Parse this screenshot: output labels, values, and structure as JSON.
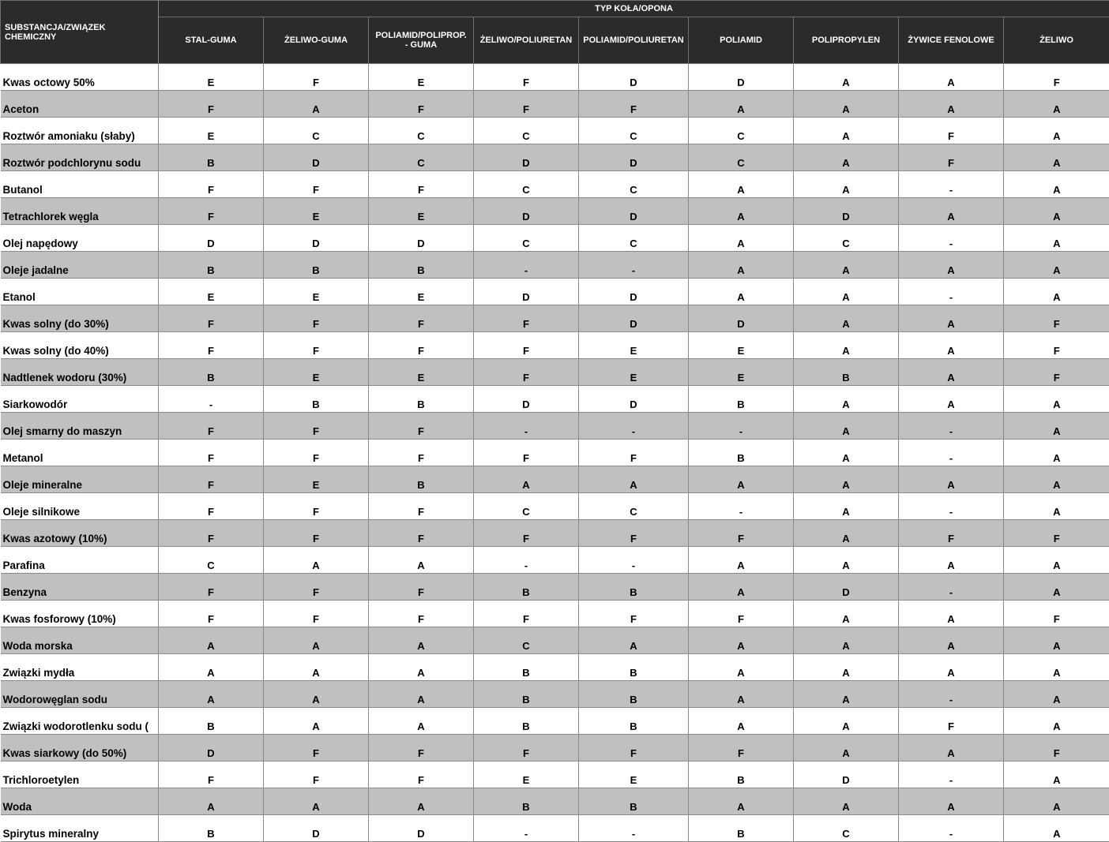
{
  "header": {
    "first_col": "SUBSTANCJA/ZWIĄZEK CHEMICZNY",
    "group": "TYP KOŁA/OPONA",
    "columns": [
      "STAL-GUMA",
      "ŻELIWO-GUMA",
      "POLIAMID/POLIPROP.\n- GUMA",
      "ŻELIWO/POLIURETAN",
      "POLIAMID/POLIURETAN",
      "POLIAMID",
      "POLIPROPYLEN",
      "ŻYWICE FENOLOWE",
      "ŻELIWO"
    ]
  },
  "rows": [
    {
      "name": "Kwas octowy 50%",
      "values": [
        "E",
        "F",
        "E",
        "F",
        "D",
        "D",
        "A",
        "A",
        "F"
      ]
    },
    {
      "name": "Aceton",
      "values": [
        "F",
        "A",
        "F",
        "F",
        "F",
        "A",
        "A",
        "A",
        "A"
      ]
    },
    {
      "name": "Roztwór amoniaku (słaby)",
      "values": [
        "E",
        "C",
        "C",
        "C",
        "C",
        "C",
        "A",
        "F",
        "A"
      ]
    },
    {
      "name": "Roztwór podchlorynu sodu",
      "values": [
        "B",
        "D",
        "C",
        "D",
        "D",
        "C",
        "A",
        "F",
        "A"
      ]
    },
    {
      "name": "Butanol",
      "values": [
        "F",
        "F",
        "F",
        "C",
        "C",
        "A",
        "A",
        "-",
        "A"
      ]
    },
    {
      "name": "Tetrachlorek węgla",
      "values": [
        "F",
        "E",
        "E",
        "D",
        "D",
        "A",
        "D",
        "A",
        "A"
      ]
    },
    {
      "name": "Olej napędowy",
      "values": [
        "D",
        "D",
        "D",
        "C",
        "C",
        "A",
        "C",
        "-",
        "A"
      ]
    },
    {
      "name": "Oleje jadalne",
      "values": [
        "B",
        "B",
        "B",
        "-",
        "-",
        "A",
        "A",
        "A",
        "A"
      ]
    },
    {
      "name": "Etanol",
      "values": [
        "E",
        "E",
        "E",
        "D",
        "D",
        "A",
        "A",
        "-",
        "A"
      ]
    },
    {
      "name": "Kwas solny (do 30%)",
      "values": [
        "F",
        "F",
        "F",
        "F",
        "D",
        "D",
        "A",
        "A",
        "F"
      ]
    },
    {
      "name": "Kwas solny (do 40%)",
      "values": [
        "F",
        "F",
        "F",
        "F",
        "E",
        "E",
        "A",
        "A",
        "F"
      ]
    },
    {
      "name": "Nadtlenek wodoru (30%)",
      "values": [
        "B",
        "E",
        "E",
        "F",
        "E",
        "E",
        "B",
        "A",
        "F"
      ]
    },
    {
      "name": "Siarkowodór",
      "values": [
        "-",
        "B",
        "B",
        "D",
        "D",
        "B",
        "A",
        "A",
        "A"
      ]
    },
    {
      "name": "Olej smarny do maszyn",
      "values": [
        "F",
        "F",
        "F",
        "-",
        "-",
        "-",
        "A",
        "-",
        "A"
      ]
    },
    {
      "name": "Metanol",
      "values": [
        "F",
        "F",
        "F",
        "F",
        "F",
        "B",
        "A",
        "-",
        "A"
      ]
    },
    {
      "name": "Oleje mineralne",
      "values": [
        "F",
        "E",
        "B",
        "A",
        "A",
        "A",
        "A",
        "A",
        "A"
      ]
    },
    {
      "name": "Oleje silnikowe",
      "values": [
        "F",
        "F",
        "F",
        "C",
        "C",
        "-",
        "A",
        "-",
        "A"
      ]
    },
    {
      "name": "Kwas azotowy (10%)",
      "values": [
        "F",
        "F",
        "F",
        "F",
        "F",
        "F",
        "A",
        "F",
        "F"
      ]
    },
    {
      "name": "Parafina",
      "values": [
        "C",
        "A",
        "A",
        "-",
        "-",
        "A",
        "A",
        "A",
        "A"
      ]
    },
    {
      "name": "Benzyna",
      "values": [
        "F",
        "F",
        "F",
        "B",
        "B",
        "A",
        "D",
        "-",
        "A"
      ]
    },
    {
      "name": "Kwas fosforowy (10%)",
      "values": [
        "F",
        "F",
        "F",
        "F",
        "F",
        "F",
        "A",
        "A",
        "F"
      ]
    },
    {
      "name": "Woda morska",
      "values": [
        "A",
        "A",
        "A",
        "C",
        "A",
        "A",
        "A",
        "A",
        "A"
      ]
    },
    {
      "name": "Związki mydła",
      "values": [
        "A",
        "A",
        "A",
        "B",
        "B",
        "A",
        "A",
        "A",
        "A"
      ]
    },
    {
      "name": "Wodorowęglan sodu",
      "values": [
        "A",
        "A",
        "A",
        "B",
        "B",
        "A",
        "A",
        "-",
        "A"
      ]
    },
    {
      "name": "Związki wodorotlenku sodu (",
      "values": [
        "B",
        "A",
        "A",
        "B",
        "B",
        "A",
        "A",
        "F",
        "A"
      ]
    },
    {
      "name": "Kwas siarkowy (do 50%)",
      "values": [
        "D",
        "F",
        "F",
        "F",
        "F",
        "F",
        "A",
        "A",
        "F"
      ]
    },
    {
      "name": "Trichloroetylen",
      "values": [
        "F",
        "F",
        "F",
        "E",
        "E",
        "B",
        "D",
        "-",
        "A"
      ]
    },
    {
      "name": "Woda",
      "values": [
        "A",
        "A",
        "A",
        "B",
        "B",
        "A",
        "A",
        "A",
        "A"
      ]
    },
    {
      "name": "Spirytus mineralny",
      "values": [
        "B",
        "D",
        "D",
        "-",
        "-",
        "B",
        "C",
        "-",
        "A"
      ]
    }
  ]
}
